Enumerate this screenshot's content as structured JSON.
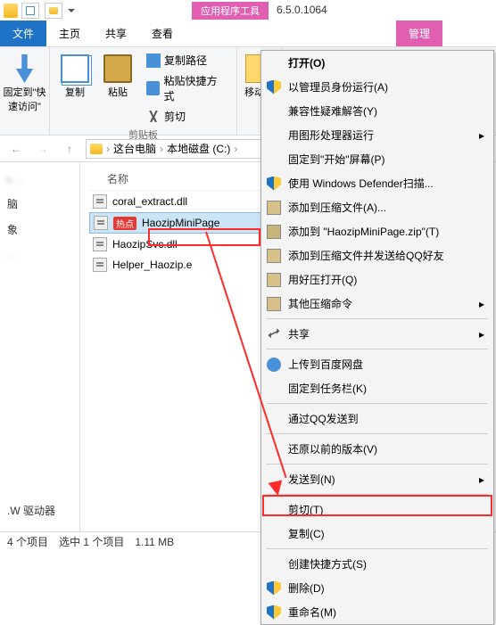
{
  "version": "6.5.0.1064",
  "ctx_tool_label": "应用程序工具",
  "tabs": {
    "file": "文件",
    "home": "主页",
    "share": "共享",
    "view": "查看",
    "manage": "管理"
  },
  "ribbon": {
    "pin": "固定到\"快速访问\"",
    "copy": "复制",
    "paste": "粘贴",
    "copy_path": "复制路径",
    "paste_shortcut": "粘贴快捷方式",
    "cut": "剪切",
    "clipboard_group": "剪贴板",
    "move_to": "移动到"
  },
  "crumbs": [
    "这台电脑",
    "本地磁盘 (C:)"
  ],
  "col_name": "名称",
  "files": [
    {
      "name": "coral_extract.dll"
    },
    {
      "name": "HaozipMiniPage",
      "hot": "热点",
      "sel": true
    },
    {
      "name": "HaozipSvc.dll"
    },
    {
      "name": "Helper_Haozip.e"
    }
  ],
  "nav": {
    "pc": "脑",
    "obj": "象",
    "drv": ".W 驱动器"
  },
  "status": {
    "count": "4 个项目",
    "sel": "选中 1 个项目",
    "size": "1.11 MB"
  },
  "menu": [
    {
      "t": "打开(O)",
      "bold": true
    },
    {
      "t": "以管理员身份运行(A)",
      "ico": "shield"
    },
    {
      "t": "兼容性疑难解答(Y)"
    },
    {
      "t": "用图形处理器运行",
      "sub": true
    },
    {
      "t": "固定到\"开始\"屏幕(P)"
    },
    {
      "t": "使用 Windows Defender扫描...",
      "ico": "shield"
    },
    {
      "t": "添加到压缩文件(A)...",
      "ico": "arc"
    },
    {
      "t": "添加到 \"HaozipMiniPage.zip\"(T)",
      "ico": "zip"
    },
    {
      "t": "添加到压缩文件并发送给QQ好友",
      "ico": "arc"
    },
    {
      "t": "用好压打开(Q)",
      "ico": "arc"
    },
    {
      "t": "其他压缩命令",
      "ico": "arc",
      "sub": true
    },
    {
      "sep": true
    },
    {
      "t": "共享",
      "ico": "share",
      "sub": true
    },
    {
      "sep": true
    },
    {
      "t": "上传到百度网盘",
      "ico": "cloud"
    },
    {
      "t": "固定到任务栏(K)"
    },
    {
      "sep": true
    },
    {
      "t": "通过QQ发送到"
    },
    {
      "sep": true
    },
    {
      "t": "还原以前的版本(V)"
    },
    {
      "sep": true
    },
    {
      "t": "发送到(N)",
      "sub": true
    },
    {
      "sep": true
    },
    {
      "t": "剪切(T)"
    },
    {
      "t": "复制(C)"
    },
    {
      "sep": true
    },
    {
      "t": "创建快捷方式(S)"
    },
    {
      "t": "删除(D)",
      "ico": "shield"
    },
    {
      "t": "重命名(M)",
      "ico": "shield"
    }
  ]
}
